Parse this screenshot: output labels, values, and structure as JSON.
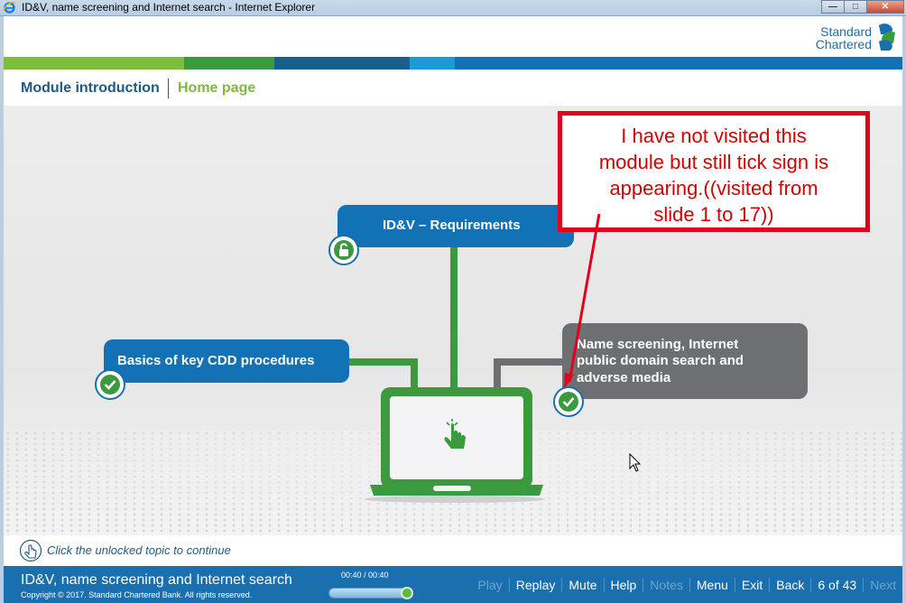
{
  "window": {
    "title": "ID&V, name screening and Internet search - Internet Explorer"
  },
  "header": {
    "logo_line1": "Standard",
    "logo_line2": "Chartered"
  },
  "colors": {
    "strip": [
      "#7dbd3c",
      "#3c9a3e",
      "#1a5e8a",
      "#1a9ad6",
      "#1272b5"
    ],
    "topic_blue": "#1272b5",
    "topic_gray": "#6e6f72",
    "green": "#3c9a3e",
    "footer": "#1a6fae",
    "callout_red": "#e3001b"
  },
  "nav": {
    "breadcrumb_module": "Module introduction",
    "breadcrumb_home": "Home page"
  },
  "topics": {
    "requirements": {
      "label": "ID&V – Requirements",
      "status_icon": "unlock-icon"
    },
    "basics": {
      "label": "Basics of key CDD procedures",
      "status_icon": "check-icon"
    },
    "name_screening": {
      "line1": "Name screening, Internet",
      "line2": "public domain search and",
      "line3": "adverse media",
      "status_icon": "check-icon"
    }
  },
  "callout": {
    "line1": "I have not visited this",
    "line2": "module but still tick sign is",
    "line3": "appearing.((visited from",
    "line4": "slide 1 to 17))"
  },
  "hint": {
    "text": "Click the unlocked topic to continue"
  },
  "footer": {
    "course_title": "ID&V, name screening and Internet search",
    "copyright": "Copyright © 2017. Standard Chartered Bank. All rights reserved.",
    "time": "00:40 / 00:40",
    "progress_fraction": 1.0,
    "buttons": {
      "play": "Play",
      "replay": "Replay",
      "mute": "Mute",
      "help": "Help",
      "notes": "Notes",
      "menu": "Menu",
      "exit": "Exit",
      "back": "Back",
      "page": "6 of 43",
      "next": "Next"
    }
  }
}
